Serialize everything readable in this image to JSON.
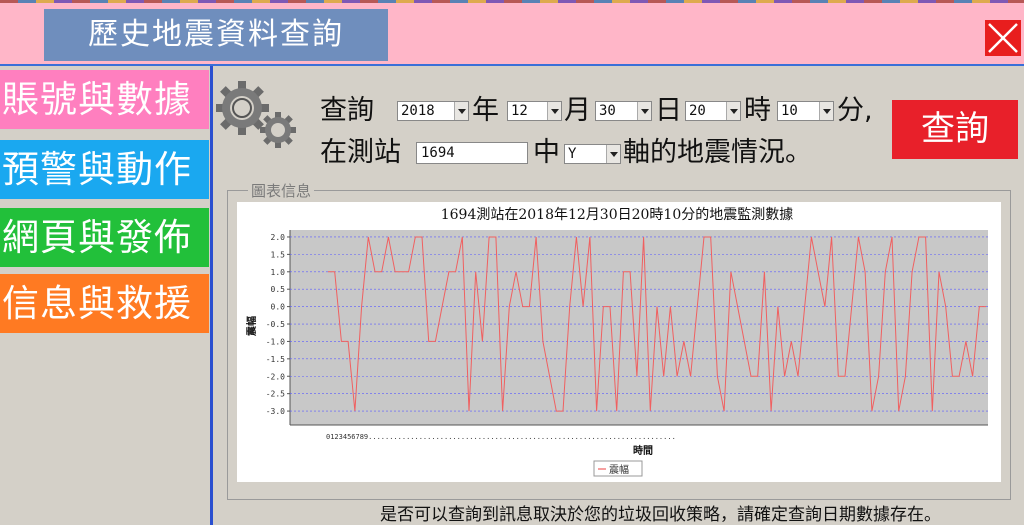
{
  "window": {
    "title": "歷史地震資料查詢",
    "close_icon": "close-icon"
  },
  "sidebar": {
    "items": [
      {
        "label": "賬號與數據",
        "color": "#ff7fbf"
      },
      {
        "label": "預警與動作",
        "color": "#1aa8f0"
      },
      {
        "label": "網頁與發佈",
        "color": "#22c03a"
      },
      {
        "label": "信息與救援",
        "color": "#ff7a22"
      }
    ]
  },
  "query": {
    "prefix": "查詢",
    "year": "2018",
    "year_unit": "年",
    "month": "12",
    "month_unit": "月",
    "day": "30",
    "day_unit": "日",
    "hour": "20",
    "hour_unit": "時",
    "minute": "10",
    "minute_unit": "分,",
    "station_prefix": "在測站",
    "station": "1694",
    "axis_prefix": "中",
    "axis": "Y",
    "suffix": "軸的地震情況。",
    "button_label": "查詢",
    "button_color": "#e8202a"
  },
  "panel": {
    "legend": "圖表信息"
  },
  "chart_data": {
    "type": "line",
    "title": "1694測站在2018年12月30日20時10分的地震監測數據",
    "xlabel": "時間",
    "ylabel": "震幅",
    "x_tick_text": "0123456789.........................................................................",
    "ylim": [
      -3.4,
      2.2
    ],
    "yticks": [
      "2.0",
      "1.5",
      "1.0",
      "0.5",
      "0.0",
      "-0.5",
      "-1.0",
      "-1.5",
      "-2.0",
      "-2.5",
      "-3.0"
    ],
    "grid": true,
    "legend_position": "bottom-center",
    "series": [
      {
        "name": "震幅",
        "color": "#f06060",
        "values": [
          1,
          1,
          -1,
          -1,
          -3,
          0,
          2,
          1,
          1,
          2,
          1,
          1,
          1,
          2,
          2,
          -1,
          -1,
          0,
          1,
          1,
          2,
          -3,
          1,
          -1,
          2,
          2,
          -3,
          0,
          1,
          0,
          0,
          2,
          -1,
          -2,
          -3,
          -3,
          0,
          2,
          0,
          2,
          -3,
          0,
          0,
          -3,
          1,
          1,
          -2,
          2,
          -3,
          0,
          -2,
          0,
          -2,
          -1,
          -2,
          0,
          2,
          2,
          -2,
          -3,
          1,
          0,
          -1,
          -2,
          -2,
          1,
          -3,
          0,
          -2,
          -1,
          -2,
          0,
          2,
          1,
          0,
          2,
          -2,
          -2,
          0,
          2,
          1,
          -3,
          -2,
          1,
          2,
          -3,
          -2,
          1,
          2,
          2,
          -3,
          1,
          0,
          -2,
          -2,
          -1,
          -2,
          0,
          0
        ]
      }
    ]
  },
  "footnote": "是否可以查詢到訊息取決於您的垃圾回收策略，請確定查詢日期數據存在。"
}
